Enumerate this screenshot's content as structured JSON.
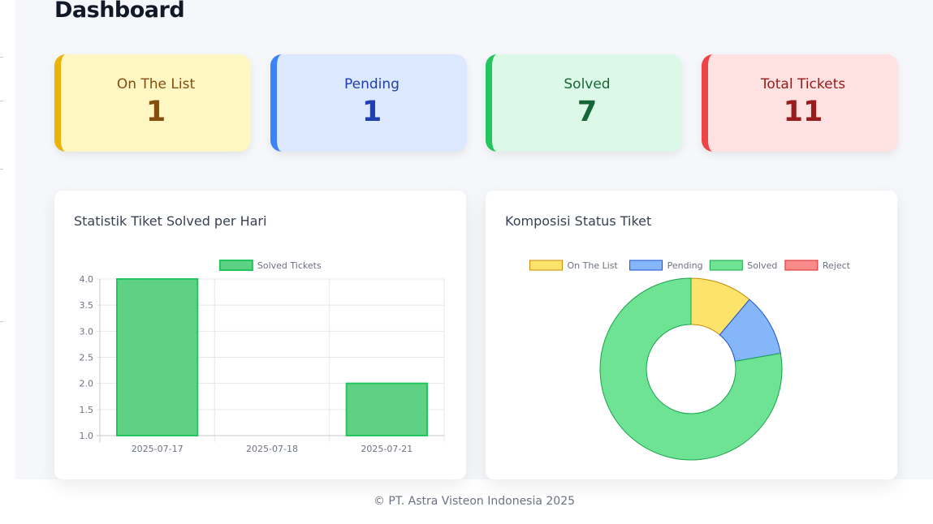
{
  "header": {
    "title": "Dashboard"
  },
  "summary_cards": [
    {
      "label": "On The List",
      "value": "1",
      "border": "#eab308",
      "bg": "#fef6c3",
      "text": "#854d0e"
    },
    {
      "label": "Pending",
      "value": "1",
      "border": "#3b82f6",
      "bg": "#dbe8fd",
      "text": "#1e40af"
    },
    {
      "label": "Solved",
      "value": "7",
      "border": "#22c55e",
      "bg": "#dcf9e7",
      "text": "#166534"
    },
    {
      "label": "Total Tickets",
      "value": "11",
      "border": "#ef4444",
      "bg": "#fee1e1",
      "text": "#991b1b"
    }
  ],
  "bar_panel": {
    "title": "Statistik Tiket Solved per Hari"
  },
  "donut_panel": {
    "title": "Komposisi Status Tiket"
  },
  "chart_data": [
    {
      "type": "bar",
      "categories": [
        "2025-07-17",
        "2025-07-18",
        "2025-07-21"
      ],
      "series": [
        {
          "name": "Solved Tickets",
          "values": [
            4,
            0,
            2
          ],
          "fill": "#5fd185",
          "stroke": "#22c55e"
        }
      ],
      "ylim": [
        1.0,
        4.0
      ],
      "yticks": [
        "1.0",
        "1.5",
        "2.0",
        "2.5",
        "3.0",
        "3.5",
        "4.0"
      ],
      "grid": true,
      "legend": "top"
    },
    {
      "type": "pie",
      "variant": "doughnut",
      "labels": [
        "On The List",
        "Pending",
        "Solved",
        "Reject"
      ],
      "values": [
        1,
        1,
        7,
        0
      ],
      "colors": [
        "#fce46b",
        "#84b6f9",
        "#6ee393",
        "#f98b8b"
      ],
      "borders": [
        "#ca8a04",
        "#1d4ed8",
        "#16a34a",
        "#dc2626"
      ],
      "legend": "top"
    }
  ],
  "footer": {
    "text": "© PT. Astra Visteon Indonesia 2025"
  }
}
